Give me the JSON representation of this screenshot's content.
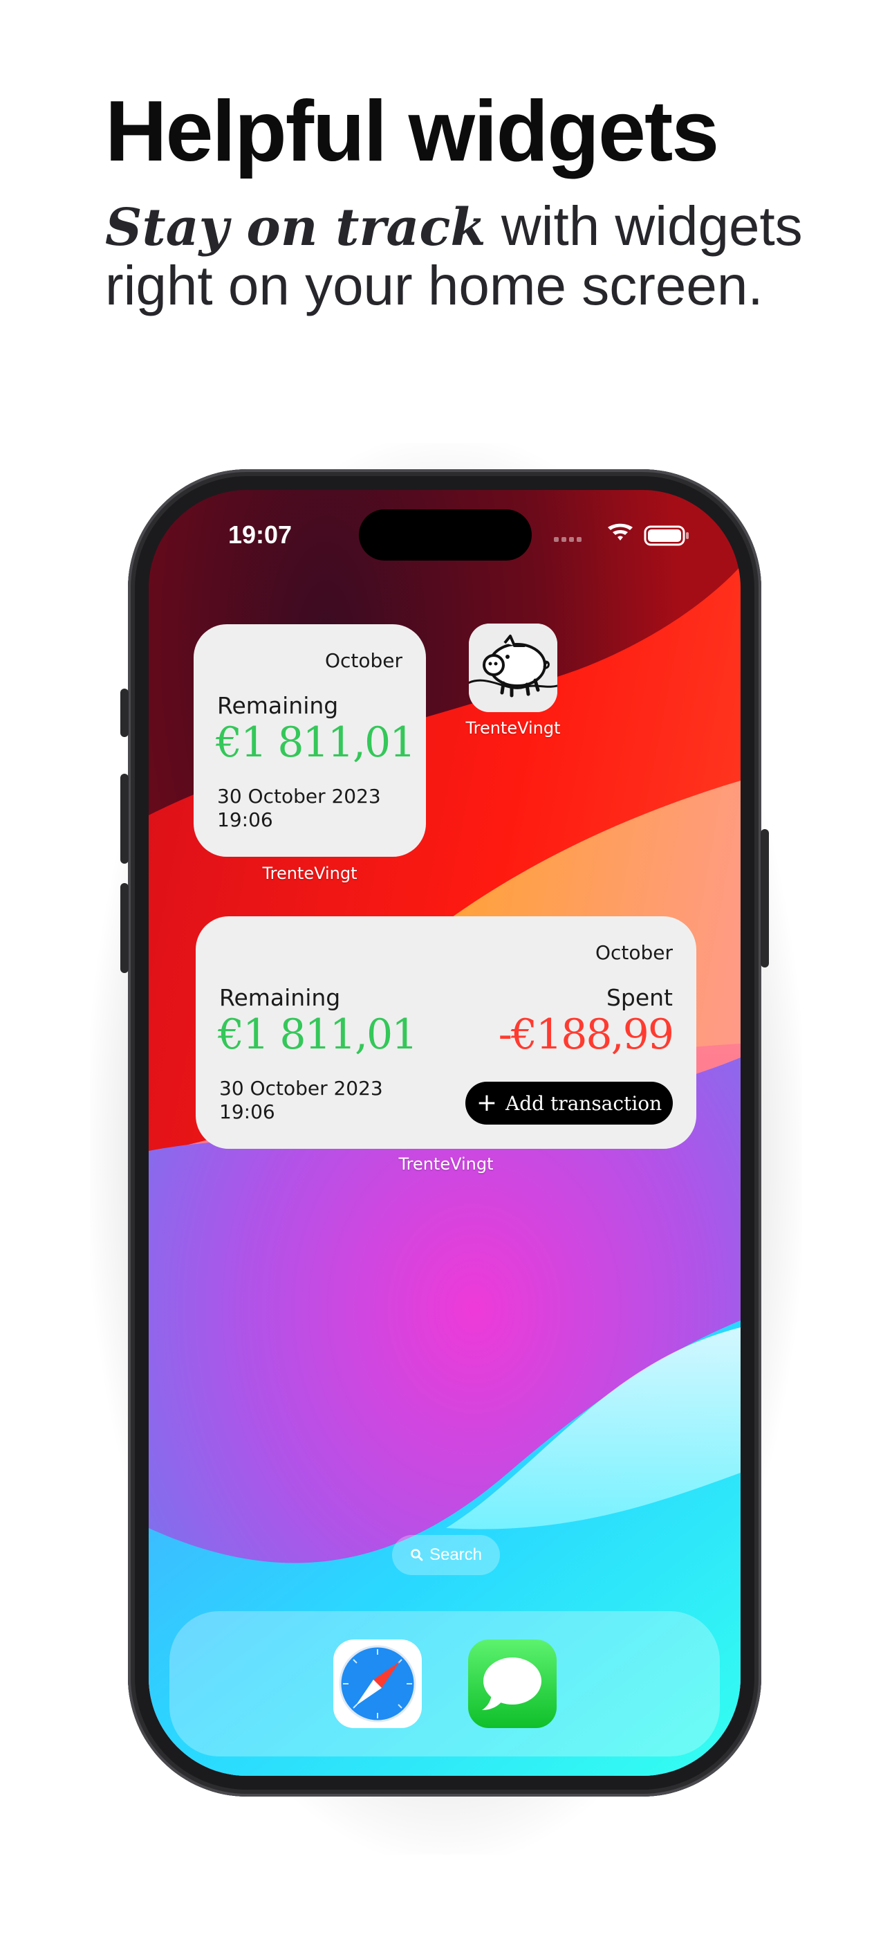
{
  "header": {
    "title": "Helpful widgets",
    "subtitle_emphasis": "Stay on track",
    "subtitle_rest": " with widgets right on your home screen."
  },
  "status_bar": {
    "time": "19:07"
  },
  "small_widget": {
    "month": "October",
    "remaining_label": "Remaining",
    "remaining_amount": "€1 811,01",
    "date_line1": "30 October 2023",
    "date_line2": "19:06",
    "caption": "TrenteVingt"
  },
  "app": {
    "name": "TrenteVingt"
  },
  "medium_widget": {
    "month": "October",
    "remaining_label": "Remaining",
    "remaining_amount": "€1 811,01",
    "spent_label": "Spent",
    "spent_amount": "-€188,99",
    "date_line1": "30 October 2023",
    "date_line2": "19:06",
    "add_button_label": "Add transaction",
    "caption": "TrenteVingt"
  },
  "search": {
    "label": "Search"
  },
  "dock": {
    "apps": [
      "safari-icon",
      "messages-icon"
    ]
  },
  "colors": {
    "positive": "#34c759",
    "negative": "#ff3b30",
    "widget_bg": "#efefef"
  }
}
